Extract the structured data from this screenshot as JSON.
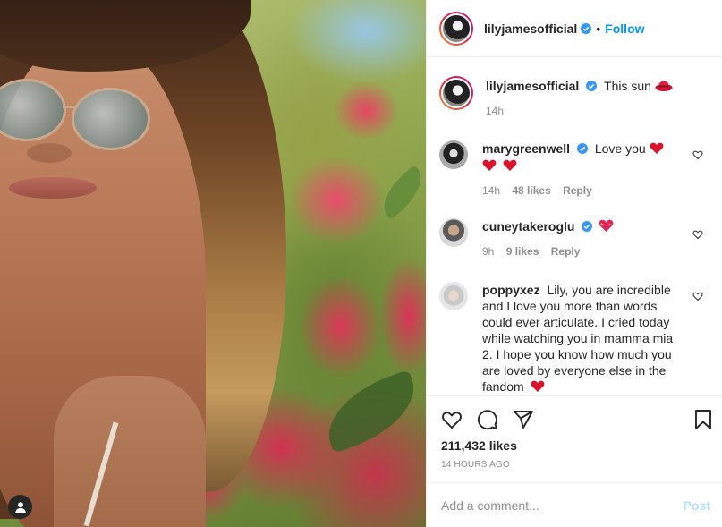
{
  "post": {
    "author": "lilyjamesofficial",
    "header_dot": "•",
    "follow_label": "Follow",
    "caption_text": "This sun",
    "caption_time": "14h",
    "likes": "211,432 likes",
    "time_ago": "14 HOURS AGO"
  },
  "comments": [
    {
      "user": "marygreenwell",
      "verified": true,
      "text": "Love you",
      "time": "14h",
      "likes": "48 likes",
      "reply": "Reply"
    },
    {
      "user": "cuneytakeroglu",
      "verified": true,
      "text": "",
      "time": "9h",
      "likes": "9 likes",
      "reply": "Reply"
    },
    {
      "user": "poppyxez",
      "verified": false,
      "text": "Lily, you are incredible and I love you more than words could ever articulate. I cried today while watching you in mamma mia 2. I hope you know how much you are loved by everyone else in the fandom"
    }
  ],
  "composer": {
    "placeholder": "Add a comment...",
    "post_label": "Post"
  },
  "colors": {
    "follow_blue": "#0095f6",
    "verified_blue": "#3897f0",
    "heart_red": "#ed4956",
    "post_disabled": "#b2dffc",
    "muted_text": "#8e8e8e"
  },
  "icons": [
    "verified-badge-icon",
    "heart-icon",
    "comment-icon",
    "share-icon",
    "bookmark-icon",
    "user-tag-icon",
    "red-heart-emoji",
    "sun-hat-emoji"
  ]
}
